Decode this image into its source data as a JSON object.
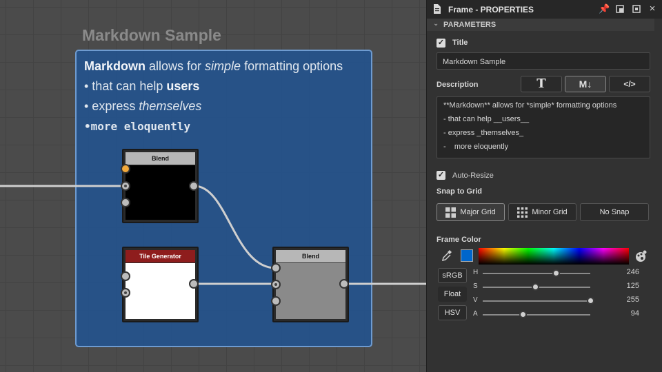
{
  "graph": {
    "frame_title": "Markdown Sample",
    "markdown": {
      "line1_bold": "Markdown",
      "line1_a": " allows for ",
      "line1_italic": "simple",
      "line1_b": " formatting options",
      "line2_a": "• that can help ",
      "line2_bold": "users",
      "line3_a": "• express ",
      "line3_italic": "themselves",
      "line4": "•more eloquently"
    },
    "nodes": {
      "blend1": "Blend",
      "tile_generator": "Tile Generator",
      "blend2": "Blend"
    }
  },
  "panel": {
    "window_title": "Frame - PROPERTIES",
    "section": "PARAMETERS",
    "title_label": "Title",
    "title_value": "Markdown Sample",
    "description_label": "Description",
    "desc_modes": [
      "T",
      "M↓",
      "</>"
    ],
    "description_lines": [
      "**Markdown** allows for *simple* formatting options",
      "- that can help __users__",
      "- express _themselves_",
      "-    more eloquently"
    ],
    "auto_resize_label": "Auto-Resize",
    "snap_label": "Snap to Grid",
    "snap_options": [
      "Major Grid",
      "Minor Grid",
      "No Snap"
    ],
    "frame_color_label": "Frame Color",
    "color_swatch": "#0066cc",
    "color_modes": [
      "sRGB",
      "Float",
      "HSV"
    ],
    "sliders": [
      {
        "label": "H",
        "value": "246",
        "fraction": 0.68
      },
      {
        "label": "S",
        "value": "125",
        "fraction": 0.49
      },
      {
        "label": "V",
        "value": "255",
        "fraction": 1.0
      },
      {
        "label": "A",
        "value": "94",
        "fraction": 0.37
      }
    ]
  }
}
